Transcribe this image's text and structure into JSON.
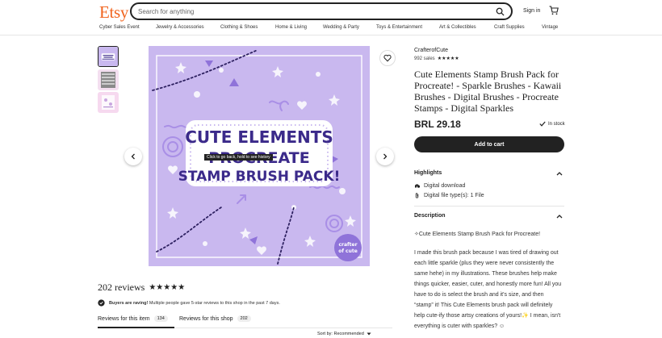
{
  "header": {
    "logo": "Etsy",
    "search_placeholder": "Search for anything",
    "signin": "Sign in"
  },
  "categories": [
    "Cyber Sales Event",
    "Jewelry & Accessories",
    "Clothing & Shoes",
    "Home & Living",
    "Wedding & Party",
    "Toys & Entertainment",
    "Art & Collectibles",
    "Craft Supplies",
    "Vintage"
  ],
  "image": {
    "heading_line1": "CUTE ELEMENTS",
    "heading_line2": "PROCREATE",
    "heading_line3": "STAMP BRUSH PACK!",
    "badge_line1": "crafter",
    "badge_line2": "of cute",
    "tooltip": "Click to go back, hold to see history",
    "bg_color": "#c9b8ef",
    "accent_color": "#3b2a8a"
  },
  "listing": {
    "shop": "CrafterofCute",
    "sales": "992 sales",
    "title": "Cute Elements Stamp Brush Pack for Procreate! - Sparkle Brushes - Kawaii Brushes - Digital Brushes - Procreate Stamps - Digital Sparkles",
    "price": "BRL 29.18",
    "stock": "In stock",
    "add_to_cart": "Add to cart",
    "highlights_title": "Highlights",
    "highlights": [
      "Digital download",
      "Digital file type(s): 1 File"
    ],
    "description_title": "Description",
    "description_intro": "✧Cute Elements Stamp Brush Pack for Procreate!",
    "description_body": "I made this brush pack because I was tired of drawing out each little sparkle (plus they were never consistently the same hehe) in my illustrations. These brushes help make things quicker, easier, cuter, and honestly more fun! All you have to do is select the brush and it's size, and then “stamp” it! This Cute Elements brush pack will definitely help cute-ify those artsy creations of yours!✨ I mean, isn't everything is cuter with sparkles? ☺"
  },
  "reviews": {
    "title": "202 reviews",
    "raving_bold": "Buyers are raving!",
    "raving_text": "Multiple people gave 5-star reviews to this shop in the past 7 days.",
    "tab_item": "Reviews for this item",
    "tab_item_count": "134",
    "tab_shop": "Reviews for this shop",
    "tab_shop_count": "202",
    "sort_label": "Sort by: Recommended"
  }
}
